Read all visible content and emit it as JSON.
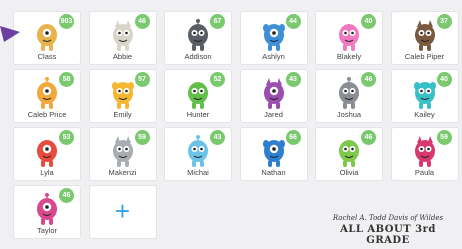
{
  "students": [
    {
      "name": "Class",
      "points": "903",
      "color": "#e8b34a",
      "icon": "class-group-monster-icon"
    },
    {
      "name": "Abbie",
      "points": "46",
      "color": "#d9d4c8",
      "icon": "monster-avatar-icon"
    },
    {
      "name": "Addison",
      "points": "67",
      "color": "#5a5f66",
      "icon": "monster-avatar-icon"
    },
    {
      "name": "Ashlyn",
      "points": "44",
      "color": "#3f8fd8",
      "icon": "monster-avatar-icon"
    },
    {
      "name": "Blakely",
      "points": "40",
      "color": "#f07ac0",
      "icon": "monster-avatar-icon"
    },
    {
      "name": "Caleb Piper",
      "points": "37",
      "color": "#7a5a3e",
      "icon": "monster-avatar-icon"
    },
    {
      "name": "Caleb Price",
      "points": "58",
      "color": "#f0a93a",
      "icon": "monster-avatar-icon"
    },
    {
      "name": "Emily",
      "points": "57",
      "color": "#f5b731",
      "icon": "monster-avatar-icon"
    },
    {
      "name": "Hunter",
      "points": "52",
      "color": "#62c04a",
      "icon": "monster-avatar-icon"
    },
    {
      "name": "Jared",
      "points": "43",
      "color": "#9a4fb0",
      "icon": "monster-avatar-icon"
    },
    {
      "name": "Joshua",
      "points": "46",
      "color": "#8a8d92",
      "icon": "monster-avatar-icon"
    },
    {
      "name": "Kailey",
      "points": "40",
      "color": "#38c0c7",
      "icon": "monster-avatar-icon"
    },
    {
      "name": "Lyla",
      "points": "53",
      "color": "#e64b3c",
      "icon": "monster-avatar-icon"
    },
    {
      "name": "Makenzi",
      "points": "59",
      "color": "#a9adb2",
      "icon": "monster-avatar-icon"
    },
    {
      "name": "Michai",
      "points": "43",
      "color": "#6cc3e6",
      "icon": "monster-avatar-icon"
    },
    {
      "name": "Nathan",
      "points": "66",
      "color": "#2f7fd1",
      "icon": "monster-avatar-icon"
    },
    {
      "name": "Olivia",
      "points": "46",
      "color": "#7cc94b",
      "icon": "monster-avatar-icon"
    },
    {
      "name": "Paula",
      "points": "59",
      "color": "#d9386e",
      "icon": "monster-avatar-icon"
    },
    {
      "name": "Taylor",
      "points": "46",
      "color": "#d9488f",
      "icon": "monster-avatar-icon"
    }
  ],
  "add_button": {
    "label": "+"
  },
  "watermark": {
    "line1": "Rachel A. Todd Davis of Wildes",
    "line2": "ALL ABOUT 3rd GRADE"
  },
  "accent": "#35a3e0",
  "badge_color": "#7bc96f",
  "arrow_color": "#6b3fa0"
}
